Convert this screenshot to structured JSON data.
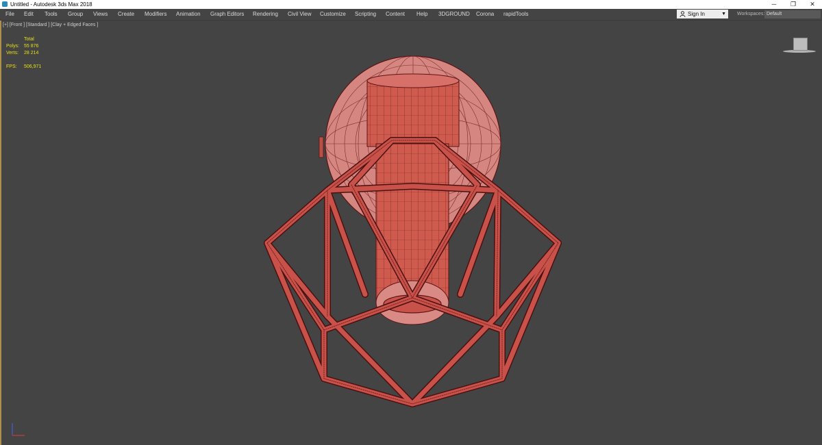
{
  "window": {
    "title": "Untitled - Autodesk 3ds Max 2018",
    "app_icon": "3ds-max-icon"
  },
  "window_controls": {
    "minimize": "─",
    "maximize": "❐",
    "close": "✕"
  },
  "menu": [
    "File",
    "Edit",
    "Tools",
    "Group",
    "Views",
    "Create",
    "Modifiers",
    "Animation",
    "Graph Editors",
    "Rendering",
    "Civil View",
    "Customize",
    "Scripting",
    "Content",
    "Help",
    "3DGROUND",
    "Corona",
    "rapidTools"
  ],
  "account": {
    "sign_in": "Sign In",
    "workspaces_label": "Workspaces:",
    "workspace": "Default"
  },
  "viewport": {
    "label": "[+] [Front ] [Standard ] [Clay + Edged Faces ]",
    "stats_header": "Total",
    "polys_label": "Polys:",
    "polys_value": "55 876",
    "verts_label": "Verts:",
    "verts_value": "28 214",
    "fps_label": "FPS:",
    "fps_value": "506,971"
  },
  "colors": {
    "model": "#c8524a",
    "wire": "#5a1414",
    "stats": "#e6e015",
    "background": "#444444"
  }
}
